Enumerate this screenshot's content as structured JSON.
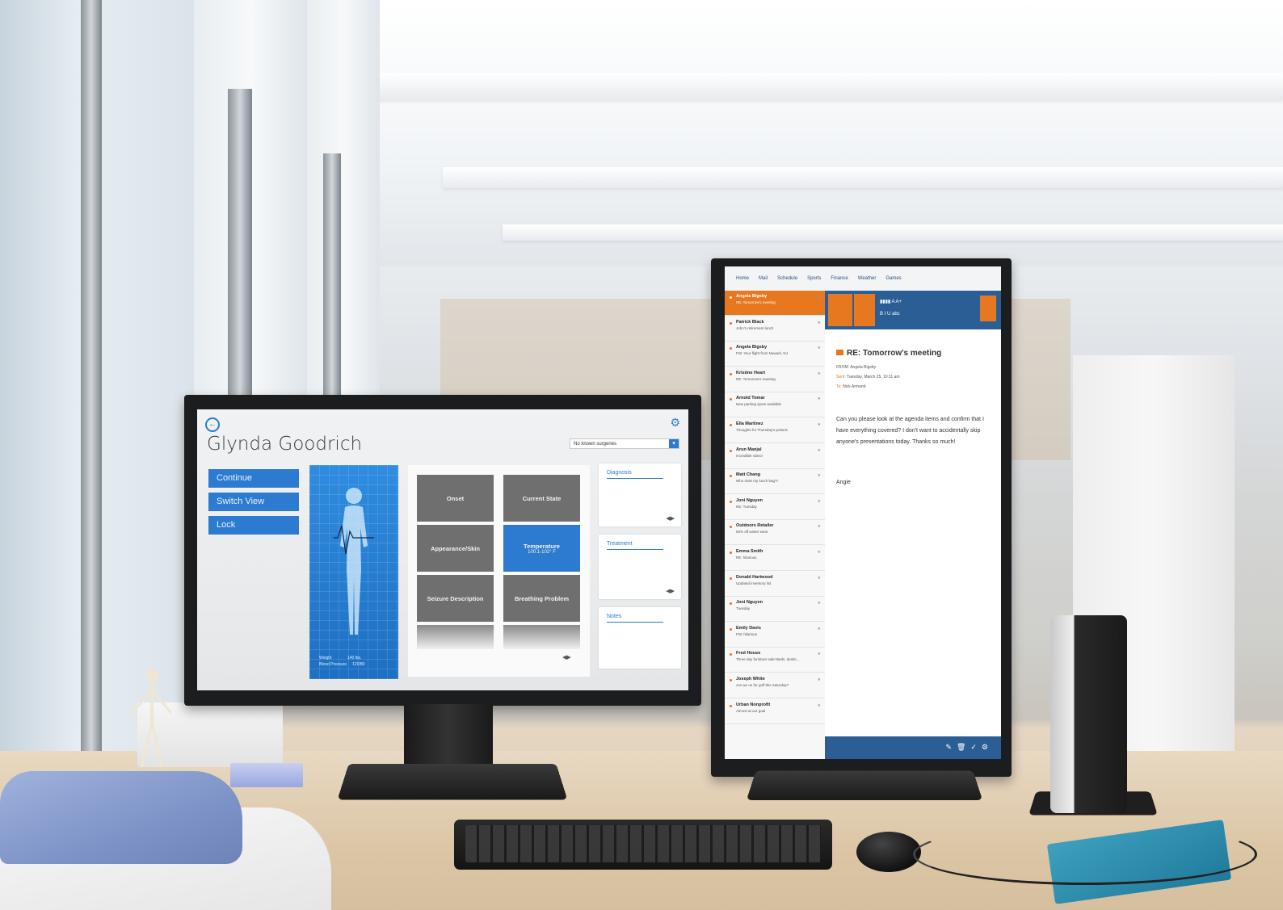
{
  "left_app": {
    "patient_name": "Glynda Goodrich",
    "surgery_select": "No known surgeries",
    "buttons": [
      "Continue",
      "Switch View",
      "Lock"
    ],
    "body_panel": {
      "weight_label": "Weight",
      "weight_value": "140 lbs.",
      "bp_label": "Blood Pressure",
      "bp_value": "120/80"
    },
    "tiles": [
      {
        "label": "Onset"
      },
      {
        "label": "Current State"
      },
      {
        "label": "Appearance/Skin"
      },
      {
        "label": "Temperature",
        "sub": "100.1-102° F",
        "active": true
      },
      {
        "label": "Seizure Description"
      },
      {
        "label": "Breathing Problem"
      }
    ],
    "cards": [
      "Diagnosis",
      "Treatment",
      "Notes"
    ]
  },
  "right_app": {
    "nav_tabs": [
      "Home",
      "Mail",
      "Schedule",
      "Sports",
      "Finance",
      "Weather",
      "Games"
    ],
    "messages": [
      {
        "name": "Angela Bigsby",
        "subject": "RE: Tomorrow's meeting",
        "selected": true
      },
      {
        "name": "Patrick Black",
        "subject": "John's retirement lunch"
      },
      {
        "name": "Angela Bigsby",
        "subject": "FW: Your flight from Newark, NJ"
      },
      {
        "name": "Kristine Heart",
        "subject": "RE: Tomorrow's meeting"
      },
      {
        "name": "Arnold Tomar",
        "subject": "New parking spots available"
      },
      {
        "name": "Ella Martinez",
        "subject": "Thoughts for Thursday's potluck"
      },
      {
        "name": "Arun Manjal",
        "subject": "Incredible video!"
      },
      {
        "name": "Matt Chang",
        "subject": "Who stole my lunch bag?!"
      },
      {
        "name": "Joni Nguyen",
        "subject": "RE: Tuesday"
      },
      {
        "name": "Outdoors Retailer",
        "subject": "50% off winter wear"
      },
      {
        "name": "Emma Smith",
        "subject": "RE: hilarious"
      },
      {
        "name": "Donald Hartwood",
        "subject": "Updated inventory list"
      },
      {
        "name": "Joni Nguyen",
        "subject": "Tuesday"
      },
      {
        "name": "Emily Davis",
        "subject": "FW: hilarious"
      },
      {
        "name": "Fred House",
        "subject": "Three day furniture sale! Beds, desks..."
      },
      {
        "name": "Joseph White",
        "subject": "Are we on for golf this Saturday?"
      },
      {
        "name": "Urban Nonprofit",
        "subject": "Almost at our goal"
      }
    ],
    "email": {
      "subject": "RE: Tomorrow's meeting",
      "from": "FROM: Angela Bigsby",
      "sent_label": "Sent:",
      "sent_value": "Tuesday, March 25, 10:11 am",
      "to_label": "To:",
      "to_value": "Nick Armand",
      "body": "Can you please look at the agenda items and confirm that I have everything covered? I don't want to accidentally skip anyone's presentations today. Thanks so much!",
      "signature": "Angie"
    }
  }
}
